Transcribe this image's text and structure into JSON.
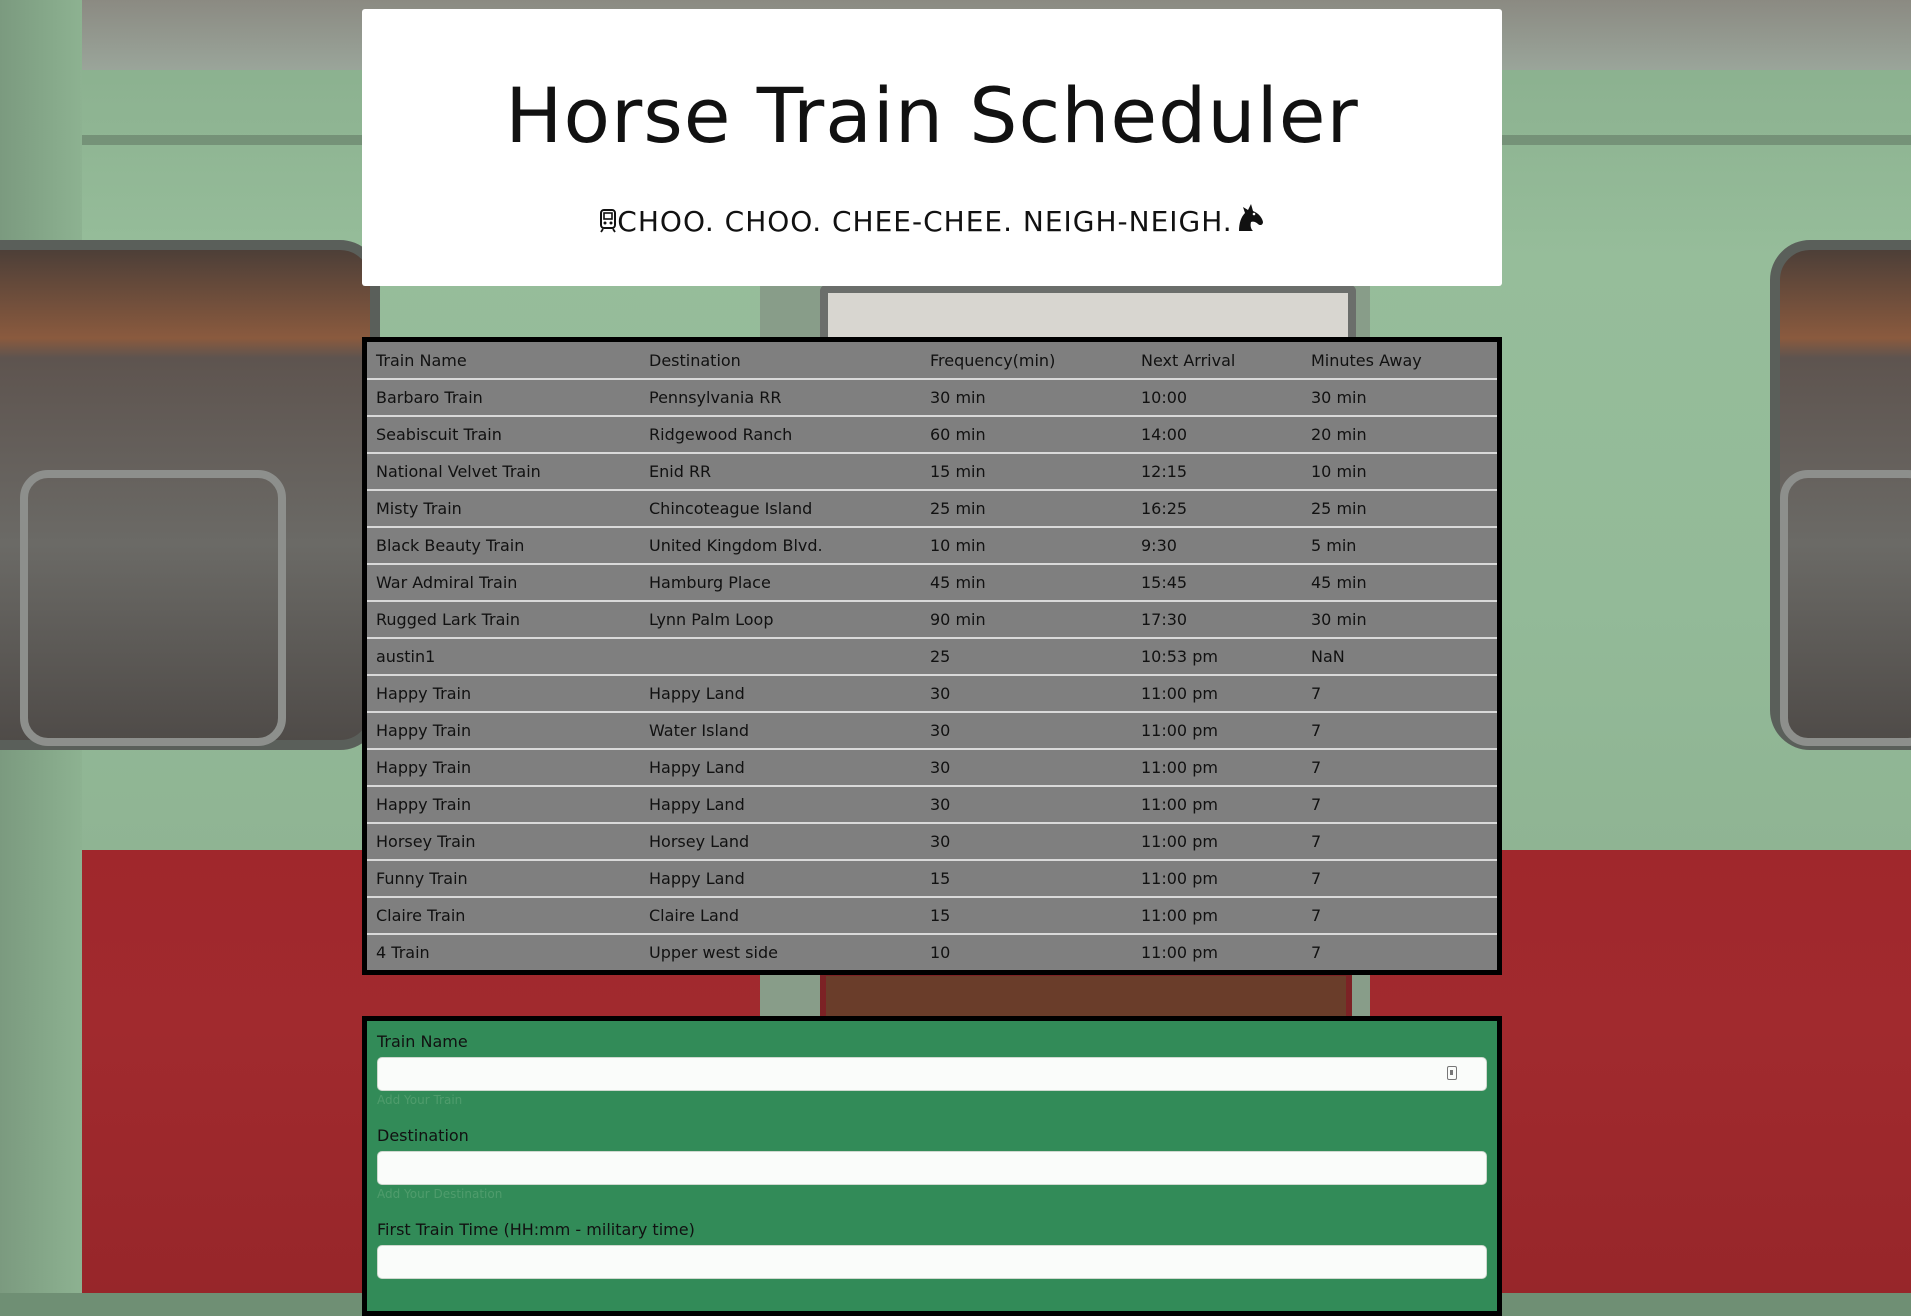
{
  "header": {
    "title": "Horse Train Scheduler",
    "subtitle": "CHOO. CHOO. CHEE-CHEE. NEIGH-NEIGH.",
    "subtitle_icon_left": "train-icon",
    "subtitle_icon_right": "horse-head-icon"
  },
  "schedule": {
    "columns": [
      "Train Name",
      "Destination",
      "Frequency(min)",
      "Next Arrival",
      "Minutes Away"
    ],
    "rows": [
      [
        "Barbaro Train",
        "Pennsylvania RR",
        "30 min",
        "10:00",
        "30 min"
      ],
      [
        "Seabiscuit Train",
        "Ridgewood Ranch",
        "60 min",
        "14:00",
        "20 min"
      ],
      [
        "National Velvet Train",
        "Enid RR",
        "15 min",
        "12:15",
        "10 min"
      ],
      [
        "Misty Train",
        "Chincoteague Island",
        "25 min",
        "16:25",
        "25 min"
      ],
      [
        "Black Beauty Train",
        "United Kingdom Blvd.",
        "10 min",
        "9:30",
        "5 min"
      ],
      [
        "War Admiral Train",
        "Hamburg Place",
        "45 min",
        "15:45",
        "45 min"
      ],
      [
        "Rugged Lark Train",
        "Lynn Palm Loop",
        "90 min",
        "17:30",
        "30 min"
      ],
      [
        "austin1",
        "",
        "25",
        "10:53 pm",
        "NaN"
      ],
      [
        "Happy Train",
        "Happy Land",
        "30",
        "11:00 pm",
        "7"
      ],
      [
        "Happy Train",
        "Water Island",
        "30",
        "11:00 pm",
        "7"
      ],
      [
        "Happy Train",
        "Happy Land",
        "30",
        "11:00 pm",
        "7"
      ],
      [
        "Happy Train",
        "Happy Land",
        "30",
        "11:00 pm",
        "7"
      ],
      [
        "Horsey Train",
        "Horsey Land",
        "30",
        "11:00 pm",
        "7"
      ],
      [
        "Funny Train",
        "Happy Land",
        "15",
        "11:00 pm",
        "7"
      ],
      [
        "Claire Train",
        "Claire Land",
        "15",
        "11:00 pm",
        "7"
      ],
      [
        "4 Train",
        "Upper west side",
        "10",
        "11:00 pm",
        "7"
      ]
    ]
  },
  "form": {
    "train_name": {
      "label": "Train Name",
      "value": "",
      "help": "Add Your Train"
    },
    "destination": {
      "label": "Destination",
      "value": "",
      "help": "Add Your Destination"
    },
    "first_time": {
      "label": "First Train Time (HH:mm - military time)",
      "value": ""
    }
  },
  "colors": {
    "form_bg": "#328b58",
    "table_bg": "#7f7f7f",
    "train_green": "#93ba98",
    "train_red": "#a12a2e"
  }
}
